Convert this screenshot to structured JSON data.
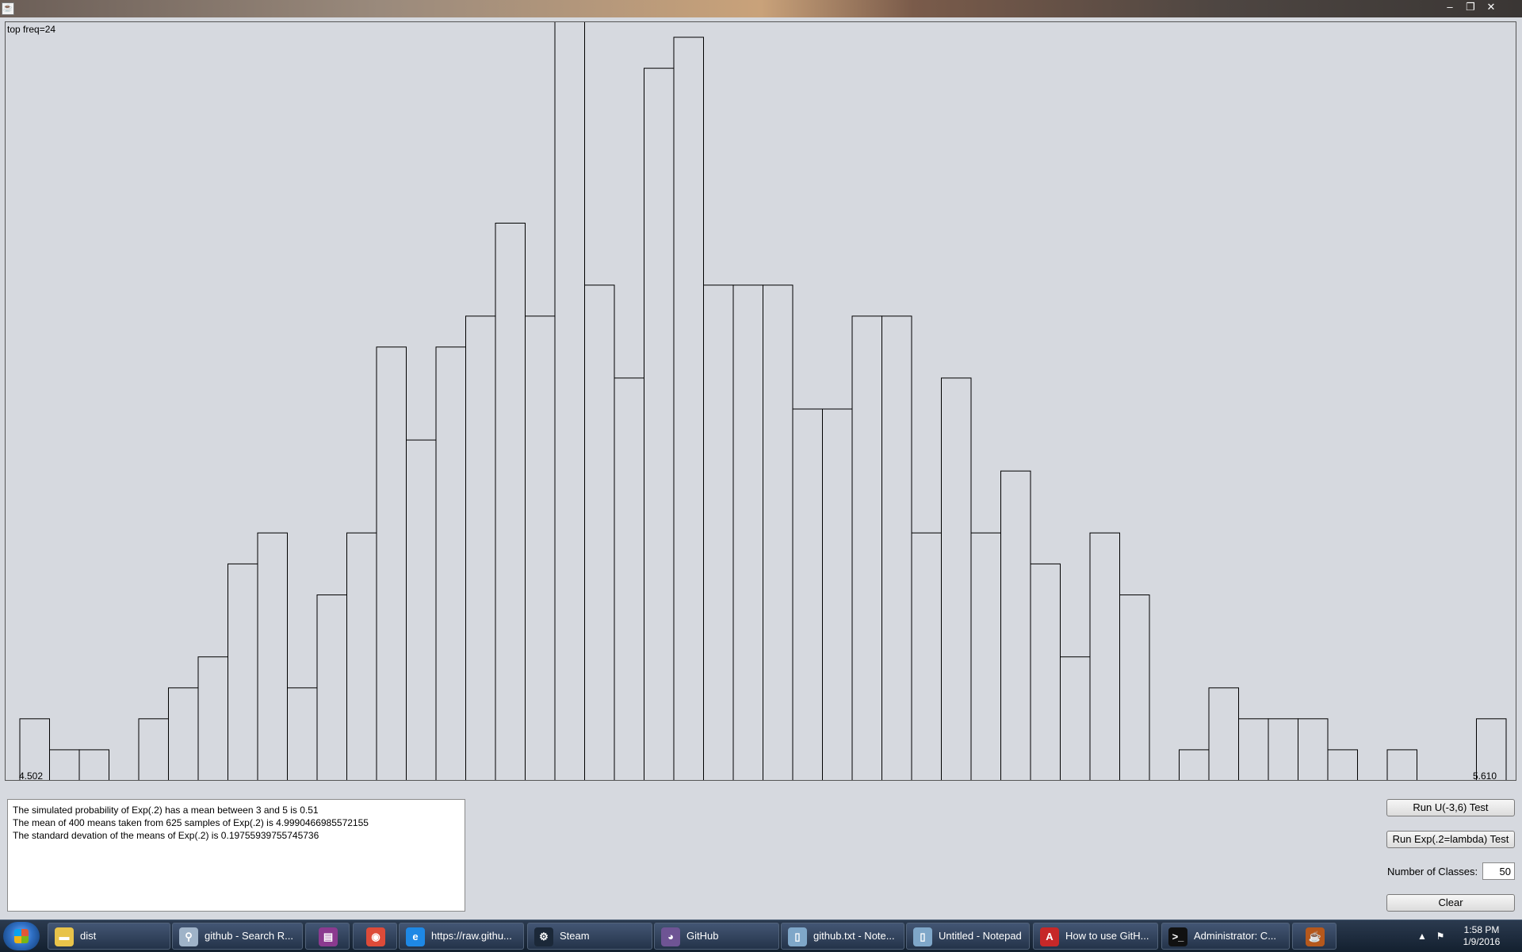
{
  "window": {
    "controls": {
      "minimize": "–",
      "restore": "❐",
      "close": "✕"
    }
  },
  "chart_data": {
    "type": "bar",
    "title": "",
    "top_label": "top freq=24",
    "x_min_label": "4.502",
    "x_max_label": "5.610",
    "top_freq": 24,
    "values": [
      2,
      1,
      1,
      0,
      2,
      3,
      4,
      7,
      8,
      3,
      6,
      8,
      14,
      11,
      14,
      15,
      18,
      15,
      26,
      16,
      13,
      23,
      24,
      16,
      16,
      16,
      12,
      12,
      15,
      15,
      8,
      13,
      8,
      10,
      7,
      4,
      8,
      6,
      0,
      1,
      3,
      2,
      2,
      2,
      1,
      0,
      1,
      0,
      0,
      2
    ],
    "grid": false,
    "colors": {
      "bar_stroke": "#000000",
      "bar_fill": "none",
      "background": "#d6d9df"
    }
  },
  "output": {
    "lines": [
      "The simulated probability of Exp(.2) has a mean between 3 and 5 is 0.51",
      "The mean of 400 means taken from 625 samples of Exp(.2) is 4.9990466985572155",
      "The standard devation of the means of Exp(.2) is 0.19755939755745736"
    ]
  },
  "controls": {
    "run_uniform_label": "Run U(-3,6) Test",
    "run_exp_label": "Run Exp(.2=lambda) Test",
    "classes_label": "Number of Classes:",
    "classes_value": "50",
    "clear_label": "Clear"
  },
  "taskbar": {
    "items": [
      {
        "label": "dist",
        "icon": "folder-icon",
        "color": "#e8c34a"
      },
      {
        "label": "github - Search R...",
        "icon": "search-icon",
        "color": "#9fb3c8"
      },
      {
        "label": "",
        "icon": "winrar-icon",
        "color": "#8b3a8f"
      },
      {
        "label": "",
        "icon": "chrome-icon",
        "color": "#dd4b39"
      },
      {
        "label": "https://raw.githu...",
        "icon": "ie-icon",
        "color": "#1e88e5"
      },
      {
        "label": "Steam",
        "icon": "steam-icon",
        "color": "#1b2838"
      },
      {
        "label": "GitHub",
        "icon": "github-icon",
        "color": "#6e5494"
      },
      {
        "label": "github.txt - Note...",
        "icon": "notepad-icon",
        "color": "#7fa7c9"
      },
      {
        "label": "Untitled - Notepad",
        "icon": "notepad-icon",
        "color": "#7fa7c9"
      },
      {
        "label": "How to use GitH...",
        "icon": "pdf-icon",
        "color": "#c62828"
      },
      {
        "label": "Administrator: C...",
        "icon": "cmd-icon",
        "color": "#111111"
      },
      {
        "label": "",
        "icon": "java-icon",
        "color": "#b5581c"
      }
    ],
    "clock_time": "1:58 PM",
    "clock_date": "1/9/2016"
  }
}
